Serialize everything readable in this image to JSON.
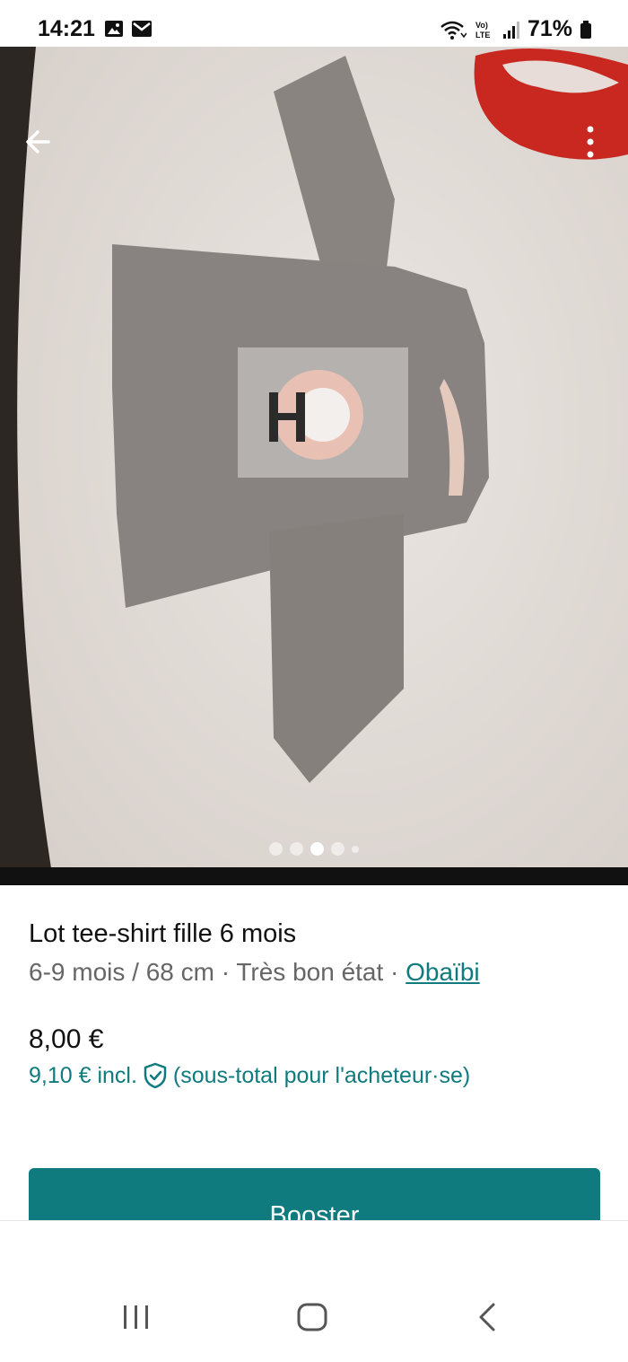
{
  "status_bar": {
    "time": "14:21",
    "battery": "71%",
    "icons": [
      "image-icon",
      "mail-icon",
      "wifi-icon",
      "volte-icon",
      "signal-icon",
      "battery-icon"
    ]
  },
  "photo": {
    "image_count": 5,
    "active_index": 2,
    "actions": [
      "back-arrow-icon",
      "more-vertical-icon"
    ]
  },
  "item": {
    "title": "Lot tee-shirt fille 6 mois",
    "details": "6-9 mois / 68 cm · Très bon état · ",
    "brand": "Obaïbi",
    "price": "8,00 €",
    "price_incl": "9,10 € incl.",
    "price_incl_note": "(sous-total pour l'acheteur·se)"
  },
  "actions": {
    "booster_label": "Booster"
  },
  "nav": {
    "items": [
      "recent-apps-icon",
      "home-icon",
      "back-icon"
    ]
  },
  "colors": {
    "accent": "#0f7b7f"
  }
}
